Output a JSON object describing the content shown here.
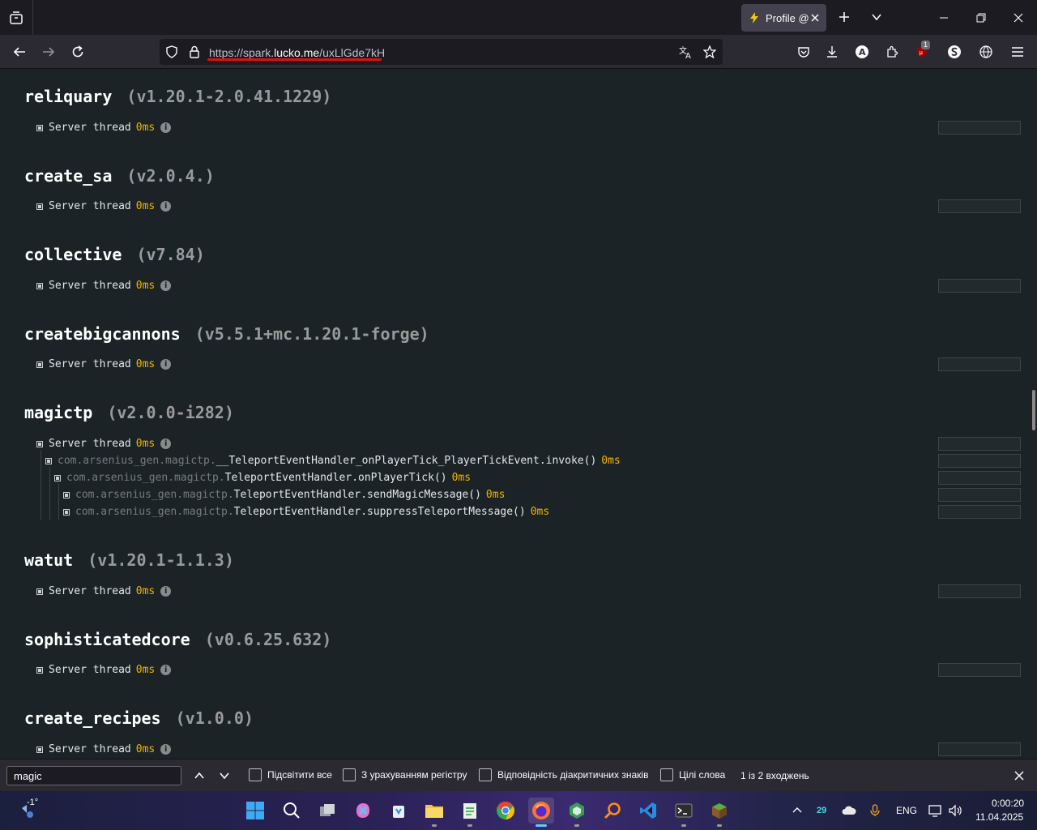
{
  "browser": {
    "tab_title": "Profile @",
    "url_prefix": "https://spark.",
    "url_host": "lucko.me",
    "url_path": "/uxLlGde7kH",
    "extension_badge": "1"
  },
  "mods": [
    {
      "name": "reliquary",
      "version": "(v1.20.1-2.0.41.1229)",
      "thread": "Server thread",
      "time": "0ms"
    },
    {
      "name": "create_sa",
      "version": "(v2.0.4.)",
      "thread": "Server thread",
      "time": "0ms"
    },
    {
      "name": "collective",
      "version": "(v7.84)",
      "thread": "Server thread",
      "time": "0ms"
    },
    {
      "name": "createbigcannons",
      "version": "(v5.5.1+mc.1.20.1-forge)",
      "thread": "Server thread",
      "time": "0ms"
    },
    {
      "name": "magictp",
      "version": "(v2.0.0-i282)",
      "thread": "Server thread",
      "time": "0ms",
      "children": [
        {
          "pkg": "com.arsenius_gen.magictp.",
          "method": "__TeleportEventHandler_onPlayerTick_PlayerTickEvent.invoke()",
          "time": "0ms"
        },
        {
          "pkg": "com.arsenius_gen.magictp.",
          "method": "TeleportEventHandler.onPlayerTick()",
          "time": "0ms"
        },
        {
          "pkg": "com.arsenius_gen.magictp.",
          "method": "TeleportEventHandler.sendMagicMessage()",
          "time": "0ms"
        },
        {
          "pkg": "com.arsenius_gen.magictp.",
          "method": "TeleportEventHandler.suppressTeleportMessage()",
          "time": "0ms"
        }
      ]
    },
    {
      "name": "watut",
      "version": "(v1.20.1-1.1.3)",
      "thread": "Server thread",
      "time": "0ms"
    },
    {
      "name": "sophisticatedcore",
      "version": "(v0.6.25.632)",
      "thread": "Server thread",
      "time": "0ms"
    },
    {
      "name": "create_recipes",
      "version": "(v1.0.0)",
      "thread": "Server thread",
      "time": "0ms"
    }
  ],
  "findbar": {
    "query": "magic",
    "highlight_all": "Підсвітити все",
    "match_case": "З урахуванням регістру",
    "match_diacritics": "Відповідність діакритичних знаків",
    "whole_words": "Цілі слова",
    "status": "1 із 2 входжень"
  },
  "taskbar": {
    "weather_temp": "-1°",
    "tray_badge": "29",
    "language": "ENG",
    "time": "0:00:20",
    "date": "11.04.2025"
  }
}
